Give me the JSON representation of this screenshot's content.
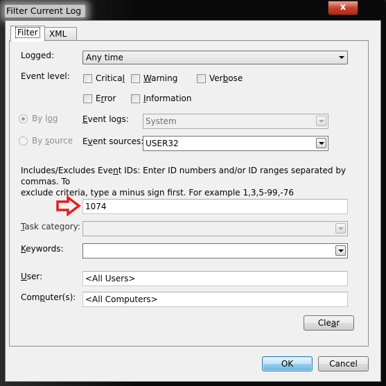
{
  "window": {
    "title": "Filter Current Log",
    "close_label": "x"
  },
  "tabs": [
    {
      "label": "Filter",
      "active": true
    },
    {
      "label": "XML",
      "active": false
    }
  ],
  "filter": {
    "logged_label": "Logged:",
    "logged_value": "Any time",
    "event_level_label": "Event level:",
    "levels": [
      {
        "pre": "Critica",
        "u": "l",
        "post": "",
        "checked": false
      },
      {
        "pre": "",
        "u": "W",
        "post": "arning",
        "checked": false
      },
      {
        "pre": "Ver",
        "u": "b",
        "post": "ose",
        "checked": false
      },
      {
        "pre": "E",
        "u": "r",
        "post": "ror",
        "checked": false
      },
      {
        "pre": "",
        "u": "I",
        "post": "nformation",
        "checked": false
      }
    ],
    "by_log": {
      "pre": "By l",
      "u": "o",
      "post": "g",
      "selected": true
    },
    "by_source": {
      "pre": "By ",
      "u": "s",
      "post": "ource",
      "selected": false
    },
    "event_logs_label": {
      "pre": "",
      "u": "E",
      "post": "vent logs:"
    },
    "event_logs_value": "System",
    "event_sources_label": {
      "pre": "E",
      "u": "v",
      "post": "ent sources:"
    },
    "event_sources_value": "USER32",
    "description_line1_pre": "Includes/Excludes Eve",
    "description_line1_u": "n",
    "description_line1_post": "t IDs: Enter ID numbers and/or ID ranges separated by commas. To",
    "description_line2": "exclude criteria, type a minus sign first. For example 1,3,5-99,-76",
    "event_ids_value": "1074",
    "task_category_label": {
      "pre": "",
      "u": "T",
      "post": "ask category:"
    },
    "task_category_value": "",
    "keywords_label": {
      "pre": "",
      "u": "K",
      "post": "eywords:"
    },
    "keywords_value": "",
    "user_label": {
      "pre": "",
      "u": "U",
      "post": "ser:"
    },
    "user_value": "<All Users>",
    "computer_label": {
      "pre": "Com",
      "u": "p",
      "post": "uter(s):"
    },
    "computer_value": "<All Computers>",
    "clear_label": {
      "pre": "Cle",
      "u": "a",
      "post": "r"
    }
  },
  "annotation": {
    "arrow_color": "#e02020"
  },
  "buttons": {
    "ok": "OK",
    "cancel": "Cancel"
  }
}
